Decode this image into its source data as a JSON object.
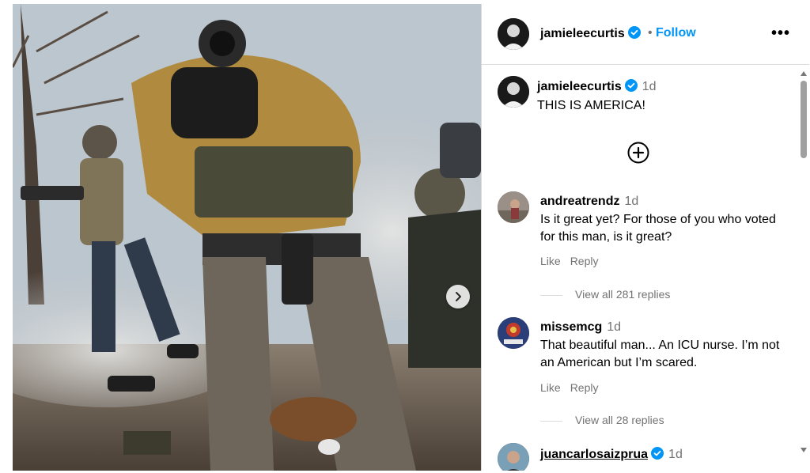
{
  "post": {
    "username": "jamieleecurtis",
    "separator": "•",
    "follow_label": "Follow",
    "more_label": "•••",
    "caption": {
      "username": "jamieleecurtis",
      "time": "1d",
      "text": "THIS IS AMERICA!"
    }
  },
  "comments": [
    {
      "username": "andreatrendz",
      "time": "1d",
      "text": "Is it great yet? For those of you who voted for this man, is it great?",
      "like_label": "Like",
      "reply_label": "Reply",
      "view_replies": "View all 281 replies"
    },
    {
      "username": "missemcg",
      "time": "1d",
      "text": "That beautiful man... An ICU nurse. I’m not an American but I’m scared.",
      "like_label": "Like",
      "reply_label": "Reply",
      "view_replies": "View all 28 replies"
    },
    {
      "username": "juancarlosaizprua",
      "time": "1d",
      "verified": true
    }
  ],
  "colors": {
    "accent": "#0095f6",
    "verified": "#0095f6",
    "muted": "#737373"
  },
  "icons": [
    "verified-icon",
    "add-comment-icon",
    "chevron-right-icon",
    "more-options-icon"
  ]
}
